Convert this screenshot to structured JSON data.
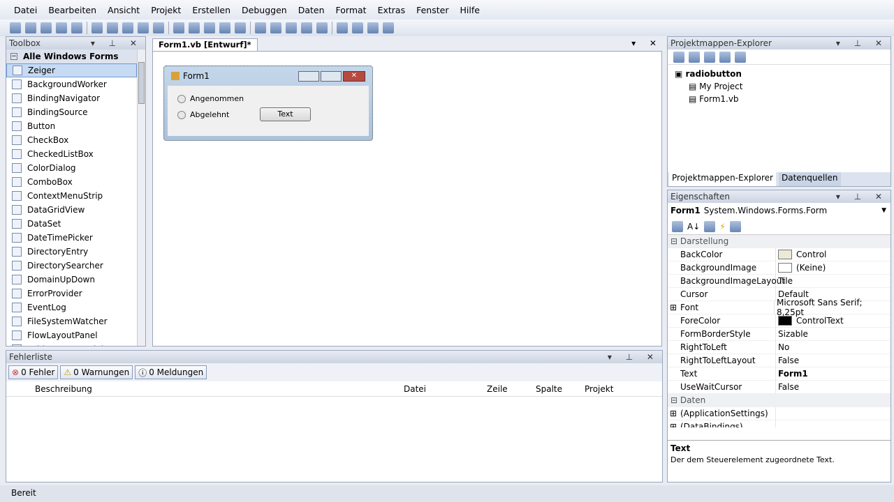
{
  "menu": [
    "Datei",
    "Bearbeiten",
    "Ansicht",
    "Projekt",
    "Erstellen",
    "Debuggen",
    "Daten",
    "Format",
    "Extras",
    "Fenster",
    "Hilfe"
  ],
  "toolbox": {
    "title": "Toolbox",
    "category": "Alle Windows Forms",
    "items": [
      {
        "label": "Zeiger",
        "icon": "pointer-icon"
      },
      {
        "label": "BackgroundWorker",
        "icon": "backgroundworker-icon"
      },
      {
        "label": "BindingNavigator",
        "icon": "bindingnavigator-icon"
      },
      {
        "label": "BindingSource",
        "icon": "bindingsource-icon"
      },
      {
        "label": "Button",
        "icon": "button-icon"
      },
      {
        "label": "CheckBox",
        "icon": "checkbox-icon"
      },
      {
        "label": "CheckedListBox",
        "icon": "checkedlistbox-icon"
      },
      {
        "label": "ColorDialog",
        "icon": "colordialog-icon"
      },
      {
        "label": "ComboBox",
        "icon": "combobox-icon"
      },
      {
        "label": "ContextMenuStrip",
        "icon": "contextmenustrip-icon"
      },
      {
        "label": "DataGridView",
        "icon": "datagridview-icon"
      },
      {
        "label": "DataSet",
        "icon": "dataset-icon"
      },
      {
        "label": "DateTimePicker",
        "icon": "datetimepicker-icon"
      },
      {
        "label": "DirectoryEntry",
        "icon": "directoryentry-icon"
      },
      {
        "label": "DirectorySearcher",
        "icon": "directorysearcher-icon"
      },
      {
        "label": "DomainUpDown",
        "icon": "domainupdown-icon"
      },
      {
        "label": "ErrorProvider",
        "icon": "errorprovider-icon"
      },
      {
        "label": "EventLog",
        "icon": "eventlog-icon"
      },
      {
        "label": "FileSystemWatcher",
        "icon": "filesystemwatcher-icon"
      },
      {
        "label": "FlowLayoutPanel",
        "icon": "flowlayoutpanel-icon"
      },
      {
        "label": "FolderBrowserDialog",
        "icon": "folderbrowserdialog-icon"
      }
    ]
  },
  "editor": {
    "tab": "Form1.vb [Entwurf]*",
    "form": {
      "title": "Form1",
      "radio1": "Angenommen",
      "radio2": "Abgelehnt",
      "button": "Text"
    }
  },
  "solution": {
    "title": "Projektmappen-Explorer",
    "root": "radiobutton",
    "children": [
      "My Project",
      "Form1.vb"
    ],
    "tabs": [
      "Projektmappen-Explorer",
      "Datenquellen"
    ]
  },
  "properties": {
    "title": "Eigenschaften",
    "object_name": "Form1",
    "object_type": "System.Windows.Forms.Form",
    "rows": [
      {
        "cat": true,
        "name": "Darstellung"
      },
      {
        "name": "BackColor",
        "value": "Control",
        "swatch": "#ece9d8"
      },
      {
        "name": "BackgroundImage",
        "value": "(Keine)",
        "swatch": "#ffffff"
      },
      {
        "name": "BackgroundImageLayout",
        "value": "Tile"
      },
      {
        "name": "Cursor",
        "value": "Default"
      },
      {
        "name": "Font",
        "value": "Microsoft Sans Serif; 8,25pt",
        "expand": true
      },
      {
        "name": "ForeColor",
        "value": "ControlText",
        "swatch": "#000000"
      },
      {
        "name": "FormBorderStyle",
        "value": "Sizable"
      },
      {
        "name": "RightToLeft",
        "value": "No"
      },
      {
        "name": "RightToLeftLayout",
        "value": "False"
      },
      {
        "name": "Text",
        "value": "Form1",
        "bold": true
      },
      {
        "name": "UseWaitCursor",
        "value": "False"
      },
      {
        "cat": true,
        "name": "Daten"
      },
      {
        "name": "(ApplicationSettings)",
        "value": "",
        "expand": true
      },
      {
        "name": "(DataBindings)",
        "value": "",
        "expand": true
      }
    ],
    "desc_title": "Text",
    "desc": "Der dem Steuerelement zugeordnete Text."
  },
  "errors": {
    "title": "Fehlerliste",
    "filters": [
      "0 Fehler",
      "0 Warnungen",
      "0 Meldungen"
    ],
    "columns": [
      "Beschreibung",
      "Datei",
      "Zeile",
      "Spalte",
      "Projekt"
    ]
  },
  "status": "Bereit"
}
